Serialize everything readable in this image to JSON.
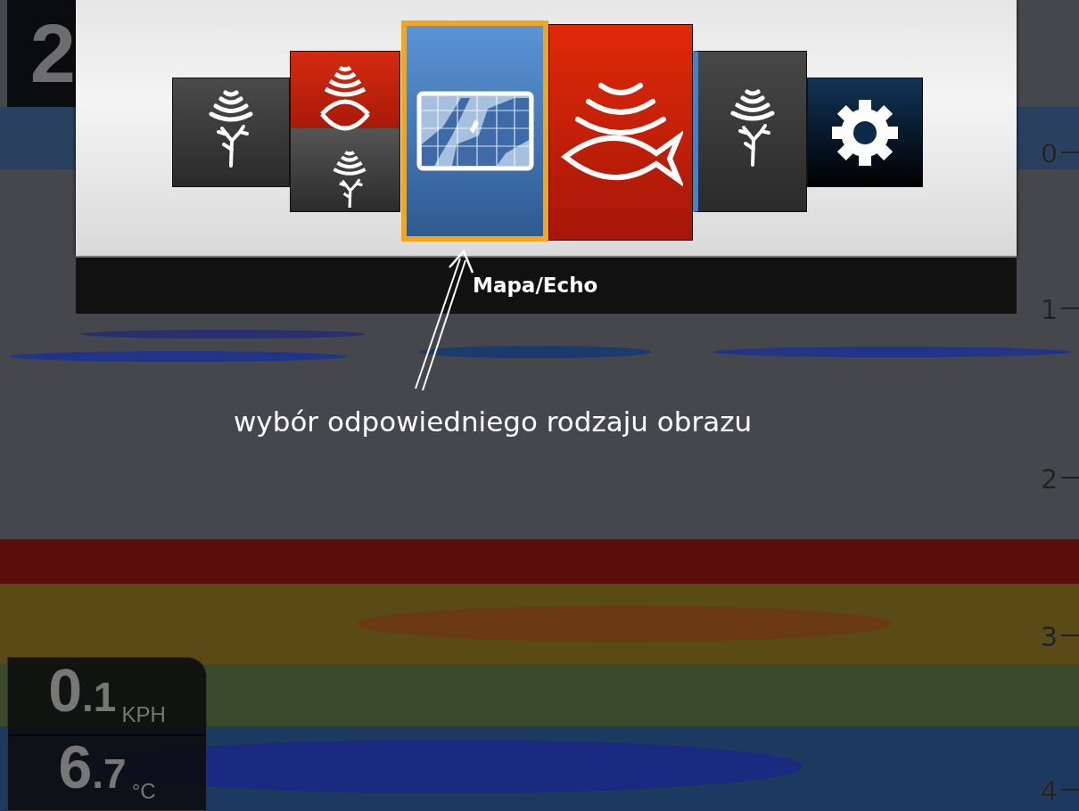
{
  "depth_readout": {
    "value": "2"
  },
  "app_menu": {
    "tiles": [
      {
        "kind": "structure",
        "selected": false
      },
      {
        "kind": "combo",
        "selected": false
      },
      {
        "kind": "chart",
        "selected": true
      },
      {
        "kind": "sonar",
        "selected": false
      },
      {
        "kind": "structure-side",
        "selected": false
      },
      {
        "kind": "settings",
        "selected": false
      }
    ],
    "label": "Mapa/Echo"
  },
  "annotation": {
    "text": "wybór odpowiedniego rodzaju obrazu"
  },
  "depth_scale": [
    "0",
    "1",
    "2",
    "3",
    "4"
  ],
  "readings": [
    {
      "value": "0.1",
      "unit": "KPH"
    },
    {
      "value": "6.7",
      "unit": "°C"
    }
  ]
}
